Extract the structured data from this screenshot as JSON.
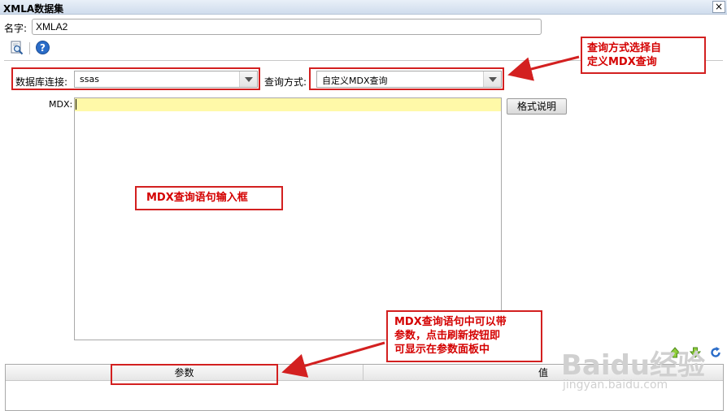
{
  "window": {
    "title": "XMLA数据集",
    "close_glyph": "×"
  },
  "name_field": {
    "label": "名字:",
    "value": "XMLA2"
  },
  "toolbar": {
    "icons": [
      "preview-icon",
      "help-icon"
    ],
    "help_glyph": "?"
  },
  "connection": {
    "label": "数据库连接:",
    "value": "ssas"
  },
  "query_mode": {
    "label": "查询方式:",
    "value": "自定义MDX查询"
  },
  "mdx": {
    "label": "MDX:",
    "value": "",
    "format_button": "格式说明"
  },
  "param_toolbar": {
    "icons": [
      "move-up-icon",
      "move-down-icon",
      "refresh-icon"
    ]
  },
  "param_table": {
    "columns": [
      "参数",
      "值"
    ]
  },
  "annotations": {
    "query_mode_note_line1": "查询方式选择自",
    "query_mode_note_line2": "定义MDX查询",
    "mdx_input_note": "MDX查询语句输入框",
    "param_note_line1": "MDX查询语句中可以带",
    "param_note_line2": "参数，点击刷新按钮即",
    "param_note_line3": "可显示在参数面板中"
  },
  "watermark": {
    "main": "Baidu经验",
    "sub": "jingyan.baidu.com"
  },
  "colors": {
    "annotation": "#d32020",
    "mdx_highlight": "#fff9a8",
    "help": "#2a6cc8"
  }
}
